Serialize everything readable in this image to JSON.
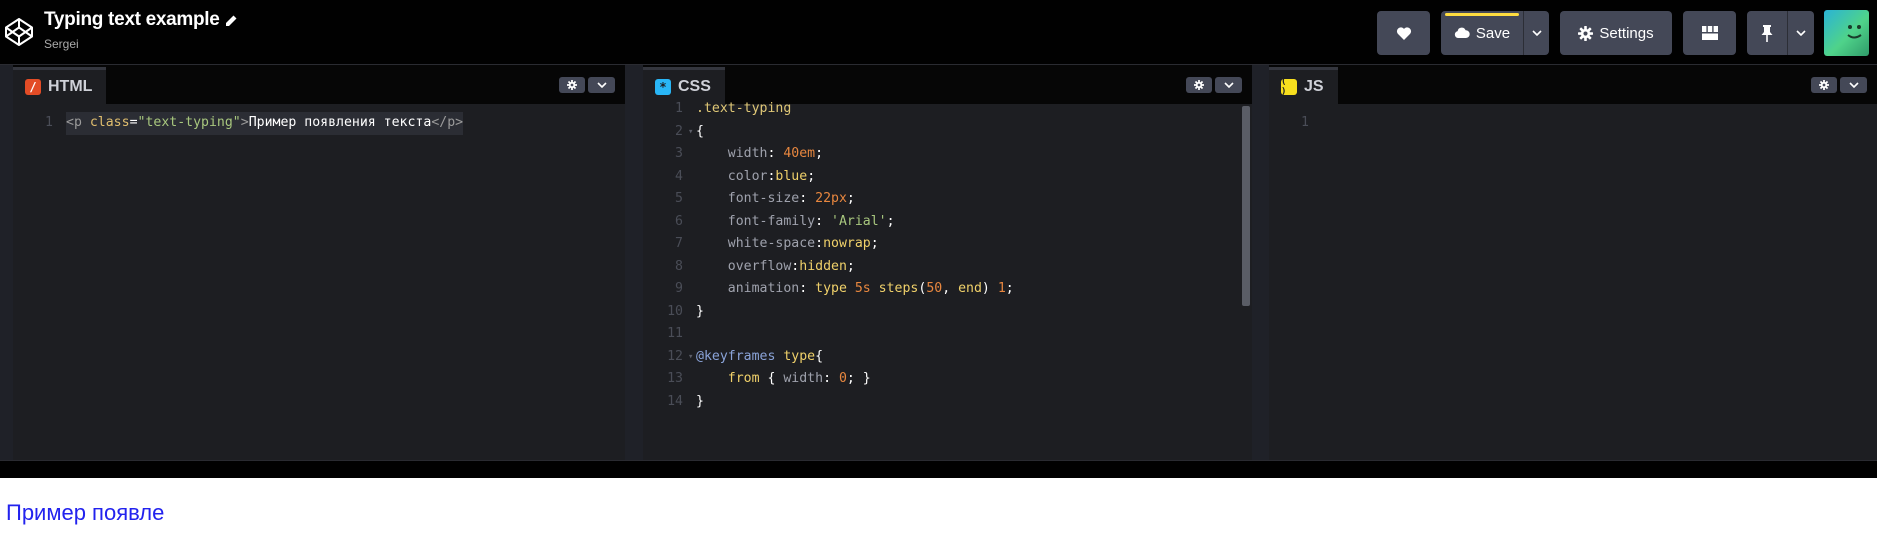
{
  "header": {
    "title": "Typing text example",
    "author": "Sergei",
    "save_label": "Save",
    "settings_label": "Settings",
    "accent_color": "#ffdd40"
  },
  "icons": [
    "codepen-logo-icon",
    "pencil-icon",
    "heart-icon",
    "cloud-icon",
    "chevron-down-icon",
    "gear-icon",
    "layout-icon",
    "pin-icon",
    "avatar"
  ],
  "editors": {
    "html": {
      "tab_label": "HTML",
      "icon_glyph": "/",
      "icon_color": "#e34c26",
      "lines": [
        {
          "n": "1",
          "tokens": [
            {
              "t": "<",
              "c": "t-tag"
            },
            {
              "t": "p",
              "c": "t-tag"
            },
            {
              "t": " ",
              "c": "t-punc"
            },
            {
              "t": "class",
              "c": "t-attr"
            },
            {
              "t": "=",
              "c": "t-punc"
            },
            {
              "t": "\"text-typing\"",
              "c": "t-str"
            },
            {
              "t": ">",
              "c": "t-tag"
            },
            {
              "t": "Пример появления текста",
              "c": "t-txt"
            },
            {
              "t": "</p>",
              "c": "t-tag"
            }
          ]
        }
      ]
    },
    "css": {
      "tab_label": "CSS",
      "icon_glyph": "*",
      "icon_color": "#29b6f6",
      "lines": [
        {
          "n": "1",
          "tokens": [
            {
              "t": ".text-typing",
              "c": "t-sel"
            }
          ]
        },
        {
          "n": "2",
          "fold": true,
          "tokens": [
            {
              "t": "{",
              "c": "t-punc"
            }
          ]
        },
        {
          "n": "3",
          "tokens": [
            {
              "t": "    ",
              "c": "t-punc"
            },
            {
              "t": "width",
              "c": "t-prop"
            },
            {
              "t": ": ",
              "c": "t-punc"
            },
            {
              "t": "40em",
              "c": "t-num"
            },
            {
              "t": ";",
              "c": "t-punc"
            }
          ]
        },
        {
          "n": "4",
          "tokens": [
            {
              "t": "    ",
              "c": "t-punc"
            },
            {
              "t": "color",
              "c": "t-prop"
            },
            {
              "t": ":",
              "c": "t-punc"
            },
            {
              "t": "blue",
              "c": "t-kw"
            },
            {
              "t": ";",
              "c": "t-punc"
            }
          ]
        },
        {
          "n": "5",
          "tokens": [
            {
              "t": "    ",
              "c": "t-punc"
            },
            {
              "t": "font-size",
              "c": "t-prop"
            },
            {
              "t": ": ",
              "c": "t-punc"
            },
            {
              "t": "22px",
              "c": "t-num"
            },
            {
              "t": ";",
              "c": "t-punc"
            }
          ]
        },
        {
          "n": "6",
          "tokens": [
            {
              "t": "    ",
              "c": "t-punc"
            },
            {
              "t": "font-family",
              "c": "t-prop"
            },
            {
              "t": ": ",
              "c": "t-punc"
            },
            {
              "t": "'Arial'",
              "c": "t-str"
            },
            {
              "t": ";",
              "c": "t-punc"
            }
          ]
        },
        {
          "n": "7",
          "tokens": [
            {
              "t": "    ",
              "c": "t-punc"
            },
            {
              "t": "white-space",
              "c": "t-prop"
            },
            {
              "t": ":",
              "c": "t-punc"
            },
            {
              "t": "nowrap",
              "c": "t-kw"
            },
            {
              "t": ";",
              "c": "t-punc"
            }
          ]
        },
        {
          "n": "8",
          "tokens": [
            {
              "t": "    ",
              "c": "t-punc"
            },
            {
              "t": "overflow",
              "c": "t-prop"
            },
            {
              "t": ":",
              "c": "t-punc"
            },
            {
              "t": "hidden",
              "c": "t-kw"
            },
            {
              "t": ";",
              "c": "t-punc"
            }
          ]
        },
        {
          "n": "9",
          "tokens": [
            {
              "t": "    ",
              "c": "t-punc"
            },
            {
              "t": "animation",
              "c": "t-prop"
            },
            {
              "t": ": ",
              "c": "t-punc"
            },
            {
              "t": "type ",
              "c": "t-kw"
            },
            {
              "t": "5s ",
              "c": "t-num"
            },
            {
              "t": "steps",
              "c": "t-kw"
            },
            {
              "t": "(",
              "c": "t-punc"
            },
            {
              "t": "50",
              "c": "t-num"
            },
            {
              "t": ", ",
              "c": "t-punc"
            },
            {
              "t": "end",
              "c": "t-kw"
            },
            {
              "t": ") ",
              "c": "t-punc"
            },
            {
              "t": "1",
              "c": "t-num"
            },
            {
              "t": ";",
              "c": "t-punc"
            }
          ]
        },
        {
          "n": "10",
          "tokens": [
            {
              "t": "}",
              "c": "t-punc"
            }
          ]
        },
        {
          "n": "11",
          "tokens": []
        },
        {
          "n": "12",
          "fold": true,
          "tokens": [
            {
              "t": "@keyframes",
              "c": "t-at"
            },
            {
              "t": " ",
              "c": "t-punc"
            },
            {
              "t": "type",
              "c": "t-kw"
            },
            {
              "t": "{",
              "c": "t-punc"
            }
          ]
        },
        {
          "n": "13",
          "tokens": [
            {
              "t": "    ",
              "c": "t-punc"
            },
            {
              "t": "from",
              "c": "t-kw"
            },
            {
              "t": " { ",
              "c": "t-punc"
            },
            {
              "t": "width",
              "c": "t-prop"
            },
            {
              "t": ": ",
              "c": "t-punc"
            },
            {
              "t": "0",
              "c": "t-num"
            },
            {
              "t": "; }",
              "c": "t-punc"
            }
          ]
        },
        {
          "n": "14",
          "tokens": [
            {
              "t": "}",
              "c": "t-punc"
            }
          ]
        }
      ]
    },
    "js": {
      "tab_label": "JS",
      "icon_glyph": "( )",
      "icon_color": "#f7df1e",
      "lines": [
        {
          "n": "1",
          "tokens": []
        }
      ]
    }
  },
  "result": {
    "text": "Пример появле"
  }
}
